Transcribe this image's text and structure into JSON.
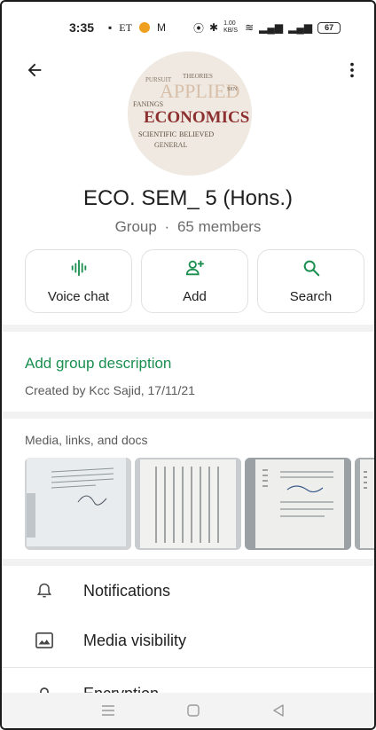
{
  "status_bar": {
    "time": "3:35",
    "left_icons": [
      "notification-icon",
      "et-icon",
      "app-icon",
      "gmail-icon"
    ],
    "network_speed": "1.00 KB/S",
    "battery": "67"
  },
  "header": {
    "back_icon": "arrow-back-icon",
    "more_icon": "more-vert-icon",
    "avatar_words": [
      "APPLIED",
      "ECONOMICS",
      "SCIENTIFIC",
      "BELIEVED",
      "GENERAL",
      "FANINGS",
      "PURSUIT",
      "THEORIES",
      "SEN"
    ]
  },
  "group": {
    "name": "ECO. SEM_ 5 (Hons.)",
    "type": "Group",
    "separator": "·",
    "members": "65 members"
  },
  "actions": [
    {
      "label": "Voice chat",
      "icon": "voice-chat-icon"
    },
    {
      "label": "Add",
      "icon": "add-person-icon"
    },
    {
      "label": "Search",
      "icon": "search-icon"
    }
  ],
  "description": {
    "link": "Add group description",
    "created_by": "Created by Kcc Sajid, 17/11/21"
  },
  "media": {
    "title": "Media, links, and docs",
    "thumbnails": [
      "declaration-page",
      "acknowledgement-page",
      "certificate-page",
      "document-page"
    ]
  },
  "settings": [
    {
      "label": "Notifications",
      "icon": "bell-icon"
    },
    {
      "label": "Media visibility",
      "icon": "image-icon"
    }
  ],
  "partial_item": {
    "label": "Encryption"
  },
  "nav": [
    "menu-icon",
    "home-icon",
    "back-triangle-icon"
  ],
  "colors": {
    "accent_green": "#1a8f50",
    "text": "#1f1f1f",
    "muted": "#6b6b6b"
  }
}
